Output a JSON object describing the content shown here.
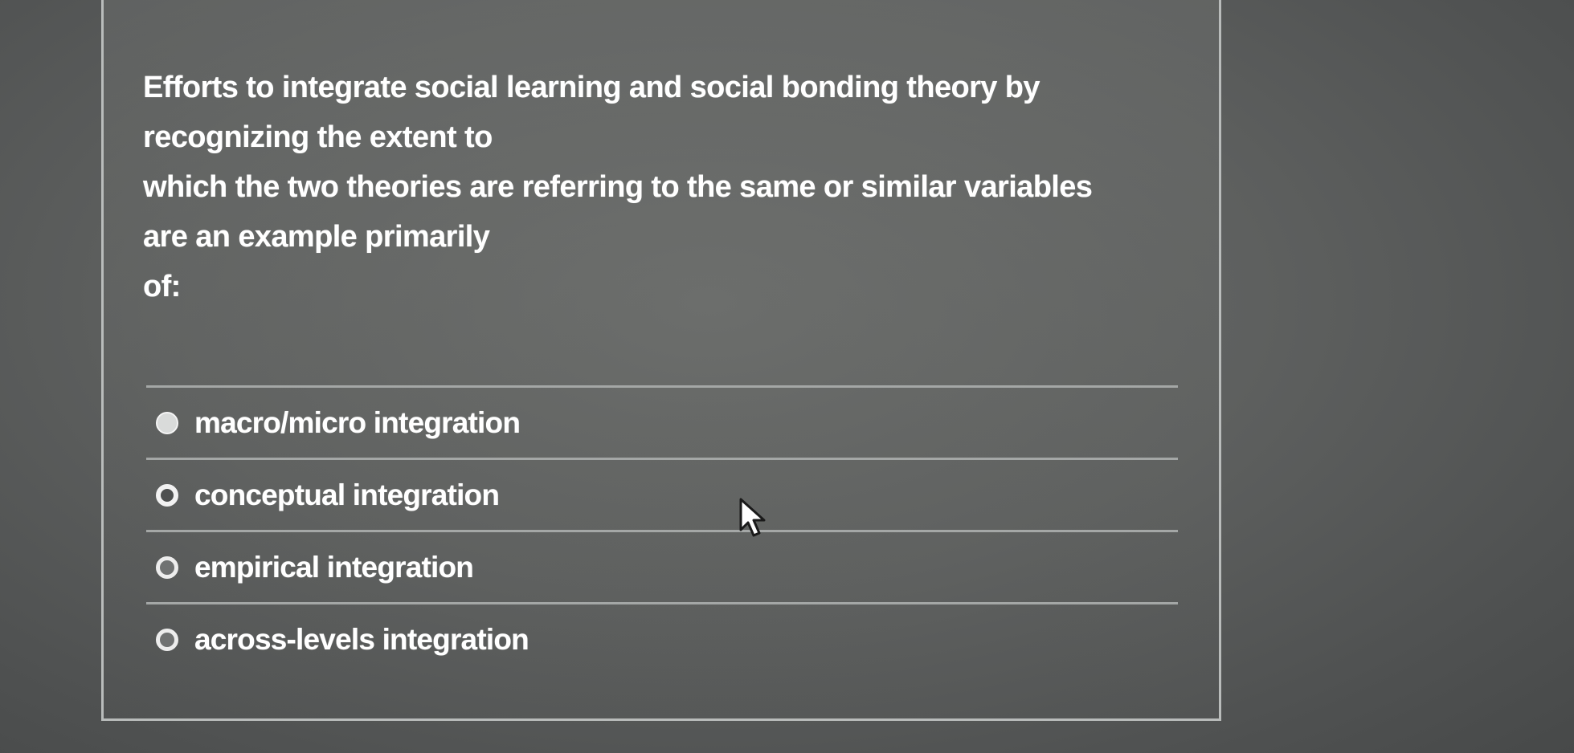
{
  "question": {
    "lines": [
      "Efforts to integrate social learning and social bonding theory by",
      "recognizing the extent to",
      "which the two theories are referring to the same or similar variables",
      "are an example primarily",
      "of:"
    ]
  },
  "options": [
    {
      "label": "macro/micro integration",
      "selected": false
    },
    {
      "label": "conceptual integration",
      "selected": false
    },
    {
      "label": "empirical integration",
      "selected": false
    },
    {
      "label": "across-levels integration",
      "selected": false
    }
  ],
  "icons": {
    "cursor": "mouse-pointer-icon",
    "radio": "radio-button-icon"
  },
  "colors": {
    "background": "#5e605f",
    "text": "#ffffff",
    "border": "#b9bcbb"
  }
}
